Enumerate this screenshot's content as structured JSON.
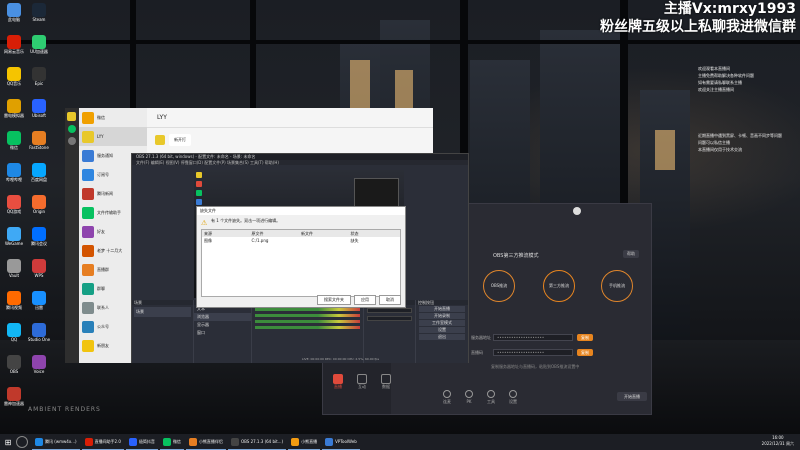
{
  "overlay": {
    "line1": "主播Vx:mrxy1993",
    "line2": "粉丝牌五级以上私聊我进微信群"
  },
  "danmu": [
    "欢迎观看本直播间",
    "主播免费帮助解决各种软件问题",
    "如有需要请私聊联系主播",
    "欢迎关注主播直播间",
    "近期直播中遇到黑屏、卡顿、音画不同步等问题",
    "问题可以私信主播",
    "本直播间仅用于技术交流"
  ],
  "desktop_icons": [
    {
      "label": "此电脑",
      "color": "#4a90e2"
    },
    {
      "label": "网易云音乐",
      "color": "#d81e06"
    },
    {
      "label": "QQ音乐",
      "color": "#f5c400"
    },
    {
      "label": "雷电模拟器",
      "color": "#e0a000"
    },
    {
      "label": "微信",
      "color": "#07c160"
    },
    {
      "label": "哔哩哔哩",
      "color": "#1e88e5"
    },
    {
      "label": "QQ游戏",
      "color": "#e84e40"
    },
    {
      "label": "WeGame",
      "color": "#3fa9f5"
    },
    {
      "label": "Vault",
      "color": "#999999"
    },
    {
      "label": "腾讯视频",
      "color": "#ff6a00"
    },
    {
      "label": "QQ",
      "color": "#12b7f5"
    },
    {
      "label": "OBS",
      "color": "#444444"
    },
    {
      "label": "雷神加速器",
      "color": "#c0392b"
    },
    {
      "label": "Steam",
      "color": "#1b2838"
    },
    {
      "label": "UU加速器",
      "color": "#2ecc71"
    },
    {
      "label": "Epic",
      "color": "#333333"
    },
    {
      "label": "Ubisoft",
      "color": "#2962ff"
    },
    {
      "label": "FastStone",
      "color": "#e67e22"
    },
    {
      "label": "百度网盘",
      "color": "#06a7ff"
    },
    {
      "label": "Origin",
      "color": "#f56c2d"
    },
    {
      "label": "腾讯会议",
      "color": "#006eff"
    },
    {
      "label": "WPS",
      "color": "#d03b3b"
    },
    {
      "label": "迅雷",
      "color": "#1890ff"
    },
    {
      "label": "Studio One",
      "color": "#2d6bd8"
    },
    {
      "label": "Voice",
      "color": "#8e44ad"
    }
  ],
  "wechat": {
    "chat_title": "LYY",
    "message": "新开打",
    "list": [
      {
        "name": "微信",
        "color": "#f0a000"
      },
      {
        "name": "LYY",
        "color": "#e8c82a"
      },
      {
        "name": "服务通知",
        "color": "#3a7bd5"
      },
      {
        "name": "订阅号",
        "color": "#2f86e0"
      },
      {
        "name": "腾讯新闻",
        "color": "#c0392b"
      },
      {
        "name": "文件传输助手",
        "color": "#07c160"
      },
      {
        "name": "好友",
        "color": "#8e44ad"
      },
      {
        "name": "老梦 十二月大",
        "color": "#d35400"
      },
      {
        "name": "直播群",
        "color": "#e67e22"
      },
      {
        "name": "群聊",
        "color": "#16a085"
      },
      {
        "name": "联系人",
        "color": "#7f8c8d"
      },
      {
        "name": "公众号",
        "color": "#2980b9"
      },
      {
        "name": "新朋友",
        "color": "#f1c40f"
      }
    ]
  },
  "obs": {
    "title": "OBS 27.1.3 (64 bit, windows) - 配置文件: 未命名 - 场景: 未命名",
    "menu": "文件(F)  编辑(E)  视图(V)  停靠窗口(D)  配置文件(P)  场景集合(S)  工具(T)  帮助(H)",
    "dock_scenes": "场景",
    "dock_sources": "来源",
    "dock_mixer": "混音器",
    "dock_transitions": "转场特效",
    "dock_controls": "控制按钮",
    "scene_item": "场景",
    "sources": [
      "文本",
      "浏览器",
      "显示器",
      "窗口"
    ],
    "controls": [
      "开始直播",
      "开始录制",
      "工作室模式",
      "设置",
      "退出"
    ],
    "status": "LIVE: 00:00:00   REC: 00:00:00   CPU: 2.5%, 60.00 fps"
  },
  "dialog": {
    "title": "缺失文件",
    "warning": "有 1 个文件缺失。双击一项进行编辑。",
    "columns": [
      "来源",
      "原文件",
      "新文件",
      "状态"
    ],
    "rows": [
      [
        "图像",
        "C:/1.png",
        "",
        "缺失"
      ]
    ],
    "buttons": [
      "搜索文件夹",
      "应用",
      "取消"
    ]
  },
  "live": {
    "title": "OBS第三方推流模式",
    "modes": [
      "OBS推流",
      "第三方推流",
      "手机推流"
    ],
    "server_label": "服务器地址",
    "key_label": "直播码",
    "copy": "复制",
    "help": "帮助",
    "tip": "复制服务器地址与直播码，粘贴到OBS推流设置中",
    "bottom_tools": [
      "连麦",
      "PK",
      "工具",
      "设置"
    ],
    "left_items": [
      "直播",
      "互动",
      "数据"
    ],
    "start": "开始直播"
  },
  "taskbar": {
    "items": [
      {
        "label": "腾讯 (wmw4x...)",
        "color": "#1e88e5"
      },
      {
        "label": "直播间助手2.0",
        "color": "#d81e06"
      },
      {
        "label": "极简抖音",
        "color": "#2962ff"
      },
      {
        "label": "微信",
        "color": "#07c160"
      },
      {
        "label": "小熊直播伴侣",
        "color": "#e67e22"
      },
      {
        "label": "OBS 27.1.3 (64 bit...)",
        "color": "#444444"
      },
      {
        "label": "小熊直播",
        "color": "#f39c12"
      },
      {
        "label": "VPToolWeb",
        "color": "#3a7bd5"
      }
    ],
    "time": "16:00",
    "date": "2022/12/31 周六"
  },
  "watermark": "AMBIENT RENDERS"
}
